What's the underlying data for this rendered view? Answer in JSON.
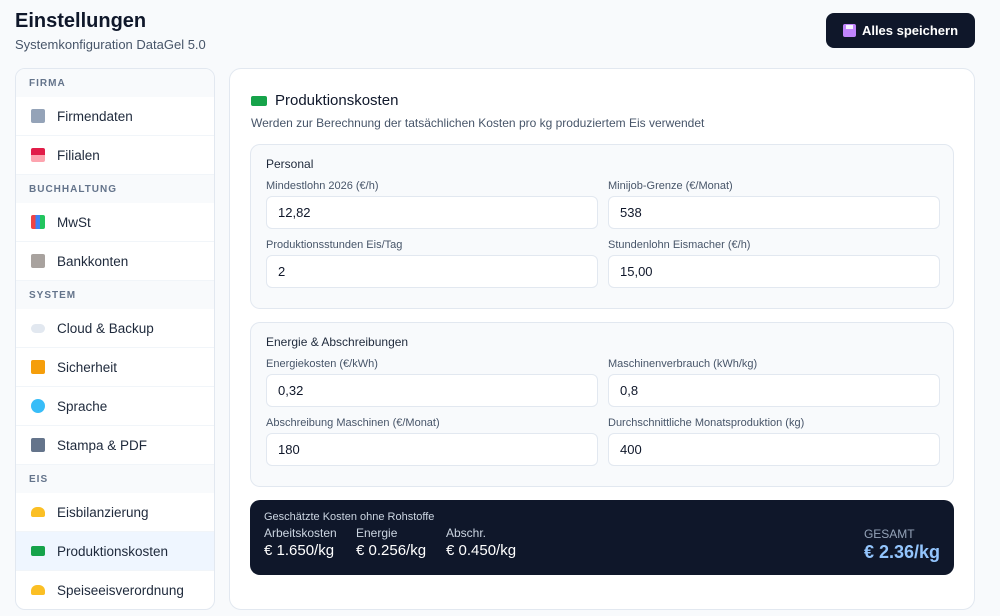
{
  "header": {
    "title": "Einstellungen",
    "subtitle": "Systemkonfiguration DataGel 5.0"
  },
  "toolbar": {
    "save_label": "Alles speichern"
  },
  "sidebar": {
    "sections": [
      {
        "label": "FIRMA",
        "items": [
          {
            "label": "Firmendaten",
            "icon": "building-icon"
          },
          {
            "label": "Filialen",
            "icon": "store-icon"
          }
        ]
      },
      {
        "label": "BUCHHALTUNG",
        "items": [
          {
            "label": "MwSt",
            "icon": "chart-icon"
          },
          {
            "label": "Bankkonten",
            "icon": "bank-icon"
          }
        ]
      },
      {
        "label": "SYSTEM",
        "items": [
          {
            "label": "Cloud & Backup",
            "icon": "cloud-icon"
          },
          {
            "label": "Sicherheit",
            "icon": "lock-icon"
          },
          {
            "label": "Sprache",
            "icon": "globe-icon"
          },
          {
            "label": "Stampa & PDF",
            "icon": "printer-icon"
          }
        ]
      },
      {
        "label": "EIS",
        "items": [
          {
            "label": "Eisbilanzierung",
            "icon": "scale-icon"
          },
          {
            "label": "Produktionskosten",
            "icon": "money-icon",
            "active": true
          },
          {
            "label": "Speiseeisverordnung",
            "icon": "scale-icon"
          }
        ]
      }
    ]
  },
  "main": {
    "title": "Produktionskosten",
    "description": "Werden zur Berechnung der tatsächlichen Kosten pro kg produziertem Eis verwendet",
    "personal": {
      "title": "Personal",
      "mindestlohn": {
        "label": "Mindestlohn 2026 (€/h)",
        "value": "12,82"
      },
      "minijob": {
        "label": "Minijob-Grenze (€/Monat)",
        "value": "538"
      },
      "stunden": {
        "label": "Produktionsstunden Eis/Tag",
        "value": "2"
      },
      "stundenlohn": {
        "label": "Stundenlohn Eismacher (€/h)",
        "value": "15,00"
      }
    },
    "energie": {
      "title": "Energie & Abschreibungen",
      "energiekosten": {
        "label": "Energiekosten (€/kWh)",
        "value": "0,32"
      },
      "maschinenverbrauch": {
        "label": "Maschinenverbrauch (kWh/kg)",
        "value": "0,8"
      },
      "abschreibung": {
        "label": "Abschreibung Maschinen (€/Monat)",
        "value": "180"
      },
      "produktion": {
        "label": "Durchschnittliche Monatsproduktion (kg)",
        "value": "400"
      }
    },
    "summary": {
      "title": "Geschätzte Kosten ohne Rohstoffe",
      "arbeit": {
        "label": "Arbeitskosten",
        "value": "€ 1.650/kg"
      },
      "energie": {
        "label": "Energie",
        "value": "€ 0.256/kg"
      },
      "abschr": {
        "label": "Abschr.",
        "value": "€ 0.450/kg"
      },
      "total": {
        "label": "GESAMT",
        "value": "€ 2.36/kg"
      }
    }
  },
  "colors": {
    "dark": "#0f172a",
    "accent": "#93c5fd",
    "active_bg": "#eff6ff"
  }
}
